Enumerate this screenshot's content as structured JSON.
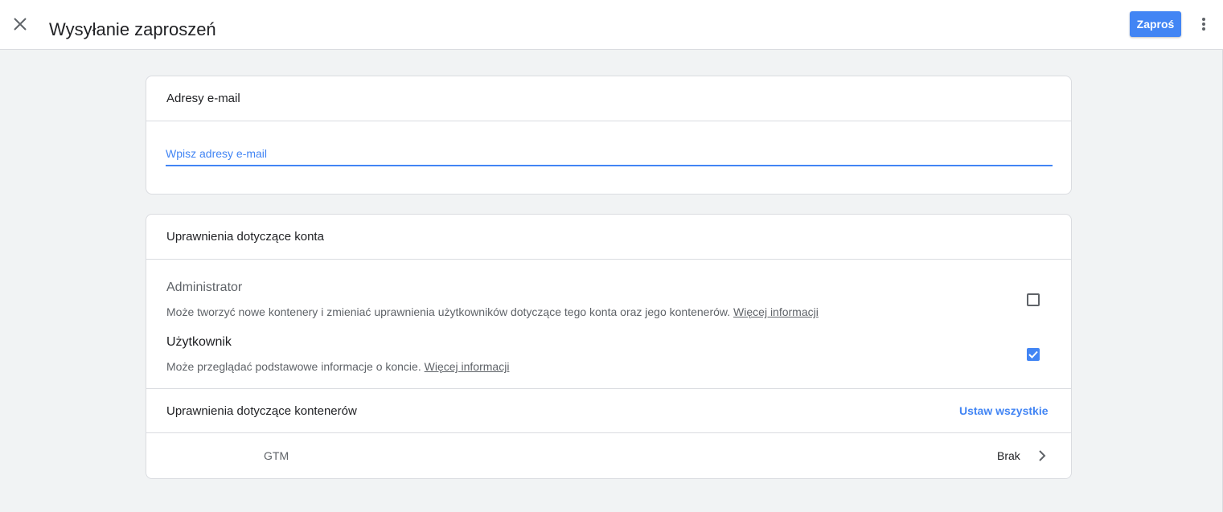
{
  "header": {
    "title": "Wysyłanie zaproszeń",
    "invite_label": "Zaproś",
    "close_icon": "close-icon",
    "more_icon": "more-vert-icon",
    "accent_color": "#4285f4"
  },
  "email_card": {
    "title": "Adresy e-mail",
    "input": {
      "placeholder": "Wpisz adresy e-mail",
      "value": ""
    }
  },
  "account_permissions": {
    "title": "Uprawnienia dotyczące konta",
    "roles": [
      {
        "title": "Administrator",
        "description": "Może tworzyć nowe kontenery i zmieniać uprawnienia użytkowników dotyczące tego konta oraz jego kontenerów.",
        "link": "Więcej informacji",
        "checked": false
      },
      {
        "title": "Użytkownik",
        "description": "Może przeglądać podstawowe informacje o koncie.",
        "link": "Więcej informacji",
        "checked": true
      }
    ]
  },
  "container_permissions": {
    "title": "Uprawnienia dotyczące kontenerów",
    "set_all_label": "Ustaw wszystkie",
    "rows": [
      {
        "name": "GTM",
        "permission": "Brak"
      }
    ]
  }
}
